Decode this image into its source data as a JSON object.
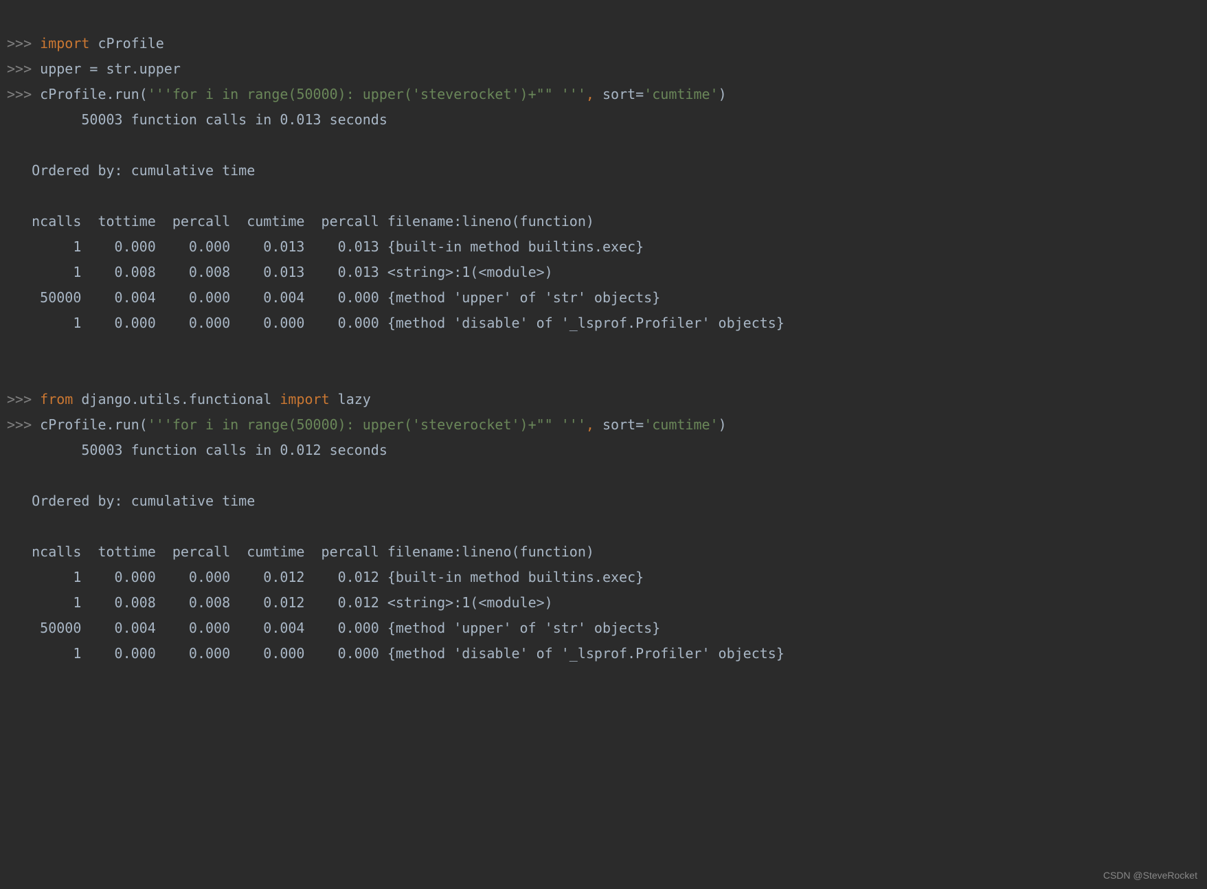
{
  "prompt": ">>>",
  "kw_import": "import",
  "kw_from": "from",
  "l1_mod": " cProfile",
  "l2": " upper = str.upper",
  "l3_a": " cProfile.run(",
  "l3_s": "'''for i in range(50000): upper('steverocket')+\"\" '''",
  "l3_c": ", ",
  "l3_d": "sort=",
  "l3_e": "'cumtime'",
  "l3_f": ")",
  "out1_l1": "         50003 function calls in 0.013 seconds",
  "blank": " ",
  "ordered": "   Ordered by: cumulative time",
  "hdr": "   ncalls  tottime  percall  cumtime  percall filename:lineno(function)",
  "r1_1": "        1    0.000    0.000    0.013    0.013 {built-in method builtins.exec}",
  "r1_2": "        1    0.008    0.008    0.013    0.013 <string>:1(<module>)",
  "r1_3": "    50000    0.004    0.000    0.004    0.000 {method 'upper' of 'str' objects}",
  "r1_4": "        1    0.000    0.000    0.000    0.000 {method 'disable' of '_lsprof.Profiler' objects}",
  "l4_a": " ",
  "l4_b": " django.utils.functional ",
  "l4_c": " lazy",
  "out2_l1": "         50003 function calls in 0.012 seconds",
  "r2_1": "        1    0.000    0.000    0.012    0.012 {built-in method builtins.exec}",
  "r2_2": "        1    0.008    0.008    0.012    0.012 <string>:1(<module>)",
  "r2_3": "    50000    0.004    0.000    0.004    0.000 {method 'upper' of 'str' objects}",
  "r2_4": "        1    0.000    0.000    0.000    0.000 {method 'disable' of '_lsprof.Profiler' objects}",
  "watermark": "CSDN @SteveRocket"
}
